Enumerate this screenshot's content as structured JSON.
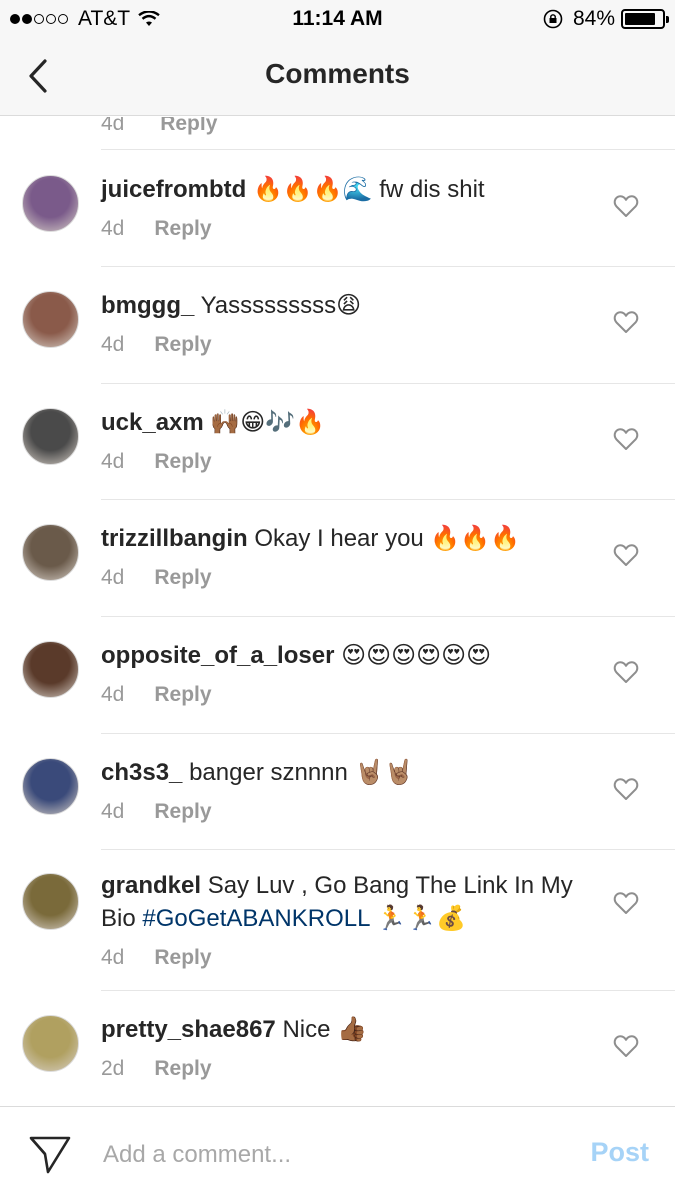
{
  "status_bar": {
    "carrier": "AT&T",
    "time": "11:14 AM",
    "battery_percent": "84%",
    "battery_level": 0.84,
    "signal_bars": 2,
    "signal_total": 5
  },
  "nav": {
    "title": "Comments",
    "back_icon": "chevron-left-icon"
  },
  "cutoff": {
    "time": "4d",
    "reply": "Reply"
  },
  "comments": [
    {
      "username": "juicefrombtd",
      "text": " 🔥🔥🔥🌊 fw dis shit",
      "time": "4d",
      "reply": "Reply",
      "avatar_color": "#7a5a8a"
    },
    {
      "username": "bmggg_",
      "text": " Yasssssssss😩",
      "time": "4d",
      "reply": "Reply",
      "avatar_color": "#8a5a4a"
    },
    {
      "username": "uck_axm",
      "text": " 🙌🏾😁🎶🔥",
      "time": "4d",
      "reply": "Reply",
      "avatar_color": "#4a4a4a"
    },
    {
      "username": "trizzillbangin",
      "text": " Okay I hear you 🔥🔥🔥",
      "time": "4d",
      "reply": "Reply",
      "avatar_color": "#6a5a4a"
    },
    {
      "username": "opposite_of_a_loser",
      "text": " 😍😍😍😍😍😍",
      "time": "4d",
      "reply": "Reply",
      "avatar_color": "#5a3a2a"
    },
    {
      "username": "ch3s3_",
      "text": " banger sznnnn 🤘🏽🤘🏽",
      "time": "4d",
      "reply": "Reply",
      "avatar_color": "#3a4a7a"
    },
    {
      "username": "grandkel",
      "text": " Say Luv , Go Bang The Link In My Bio ",
      "hashtag": "#GoGetABANKROLL",
      "after": " 🏃🏃💰",
      "time": "4d",
      "reply": "Reply",
      "avatar_color": "#7a6a3a"
    },
    {
      "username": "pretty_shae867",
      "text": " Nice 👍🏾",
      "time": "2d",
      "reply": "Reply",
      "avatar_color": "#b0a060"
    }
  ],
  "composer": {
    "placeholder": "Add a comment...",
    "post_label": "Post",
    "send_icon": "paper-plane-icon"
  },
  "colors": {
    "hashtag": "#003569",
    "post_disabled": "#a6d3f7",
    "meta_gray": "#999999"
  }
}
